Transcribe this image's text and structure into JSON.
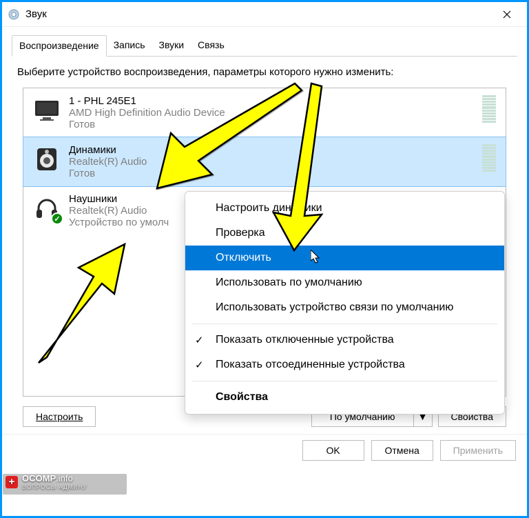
{
  "window": {
    "title": "Звук"
  },
  "tabs": [
    {
      "label": "Воспроизведение",
      "active": true
    },
    {
      "label": "Запись",
      "active": false
    },
    {
      "label": "Звуки",
      "active": false
    },
    {
      "label": "Связь",
      "active": false
    }
  ],
  "instruction": "Выберите устройство воспроизведения, параметры которого нужно изменить:",
  "devices": [
    {
      "name": "1 - PHL 245E1",
      "detail": "AMD High Definition Audio Device",
      "status": "Готов",
      "icon": "monitor",
      "selected": false,
      "default": false
    },
    {
      "name": "Динамики",
      "detail": "Realtek(R) Audio",
      "status": "Готов",
      "icon": "speaker",
      "selected": true,
      "default": false
    },
    {
      "name": "Наушники",
      "detail": "Realtek(R) Audio",
      "status": "Устройство по умолч",
      "icon": "headphones",
      "selected": false,
      "default": true
    }
  ],
  "context_menu": {
    "items": [
      {
        "label": "Настроить динамики",
        "highlight": false,
        "checked": false
      },
      {
        "label": "Проверка",
        "highlight": false,
        "checked": false
      },
      {
        "label": "Отключить",
        "highlight": true,
        "checked": false
      },
      {
        "label": "Использовать по умолчанию",
        "highlight": false,
        "checked": false
      },
      {
        "label": "Использовать устройство связи по умолчанию",
        "highlight": false,
        "checked": false
      }
    ],
    "items2": [
      {
        "label": "Показать отключенные устройства",
        "highlight": false,
        "checked": true
      },
      {
        "label": "Показать отсоединенные устройства",
        "highlight": false,
        "checked": true
      }
    ],
    "items3": [
      {
        "label": "Свойства",
        "highlight": false,
        "checked": false,
        "bold": true
      }
    ]
  },
  "buttons": {
    "configure": "Настроить",
    "default": "По умолчанию",
    "properties": "Свойства",
    "ok": "OK",
    "cancel": "Отмена",
    "apply": "Применить"
  },
  "badge": {
    "name": "OCOMP",
    "suffix": ".info",
    "tagline": "ВОПРОСЫ АДМИНУ"
  }
}
